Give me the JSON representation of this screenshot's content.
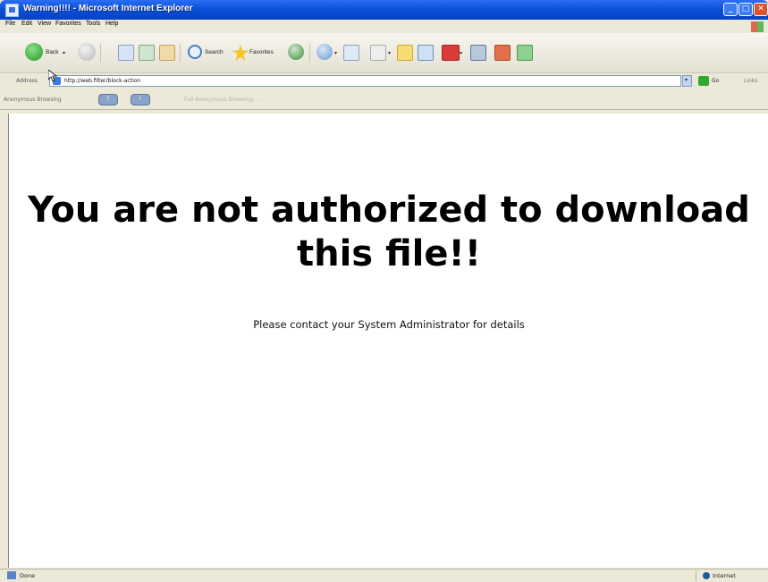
{
  "window": {
    "title": "Warning!!!! - Microsoft Internet Explorer",
    "minimize_glyph": "_",
    "maximize_glyph": "□",
    "close_glyph": "✕"
  },
  "menu": [
    "File",
    "Edit",
    "View",
    "Favorites",
    "Tools",
    "Help"
  ],
  "toolbar": {
    "back_label": "Back",
    "search_label": "Search",
    "favorites_label": "Favorites",
    "dropdown_glyph": "▾"
  },
  "address": {
    "label": "Address",
    "url": "http://web.filter/block-action",
    "dropdown_glyph": "▾",
    "go_label": "Go",
    "links_label": "Links"
  },
  "toolbar2": {
    "label": "Anonymous Browsing",
    "btn1": "?",
    "btn2": "i",
    "text": "Full Anonymous Browsing: ..."
  },
  "content": {
    "headline": "You are not authorized to download this file!!",
    "message": "Please contact your System Administrator for details"
  },
  "status": {
    "text": "Done",
    "zone": "Internet"
  },
  "colors": {
    "title_bar": "#0a50d8",
    "page_bg": "#ffffff",
    "chrome_bg": "#ece9d8"
  }
}
